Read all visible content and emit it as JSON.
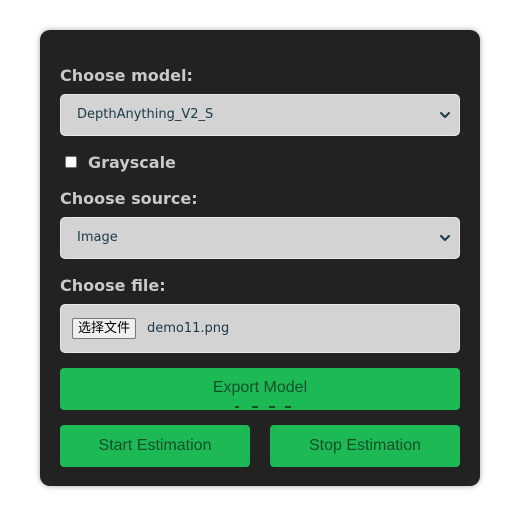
{
  "model": {
    "label": "Choose model:",
    "selected": "DepthAnything_V2_S"
  },
  "grayscale": {
    "label": "Grayscale",
    "checked": false
  },
  "source": {
    "label": "Choose source:",
    "selected": "Image"
  },
  "file": {
    "label": "Choose file:",
    "button_label": "选择文件",
    "file_name": "demo11.png"
  },
  "buttons": {
    "export": "Export Model",
    "start": "Start Estimation",
    "stop": "Stop Estimation"
  },
  "colors": {
    "panel": "#222222",
    "button_green": "#1db954",
    "field_bg": "#d3d3d3",
    "label_text": "#c9c9c9"
  },
  "icons": {
    "dropdown": "chevron-down-icon"
  }
}
